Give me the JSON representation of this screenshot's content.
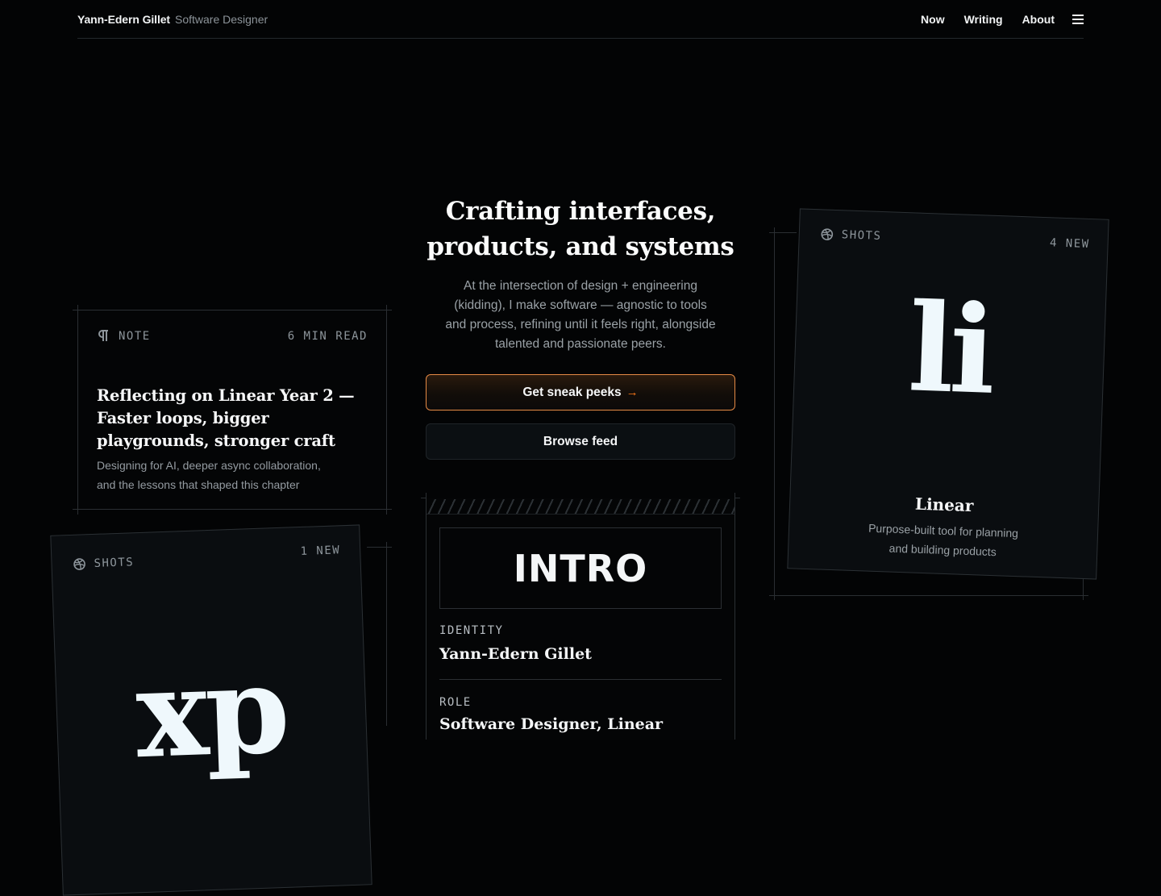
{
  "header": {
    "name": "Yann-Edern Gillet",
    "role": "Software Designer",
    "nav": [
      "Now",
      "Writing",
      "About"
    ],
    "menu_icon": "hamburger-icon"
  },
  "hero": {
    "title_line1": "Crafting interfaces,",
    "title_line2": "products, and systems",
    "subtitle": "At the intersection of design + engineering (kidding), I make software — agnostic to tools and process, refining until it feels right, alongside talented and passionate peers.",
    "primary_cta": "Get sneak peeks",
    "primary_cta_arrow": "→",
    "secondary_cta": "Browse feed"
  },
  "note_card": {
    "tag": "NOTE",
    "tag_icon": "pilcrow-icon",
    "meta": "6 MIN READ",
    "title": "Reflecting on Linear Year 2 — Faster loops, bigger playgrounds, stronger craft",
    "description": "Designing for AI, deeper async collaboration, and the lessons that shaped this chapter"
  },
  "shots_right": {
    "tag": "SHOTS",
    "tag_icon": "dribbble-icon",
    "meta": "4 NEW",
    "logo": "li",
    "title": "Linear",
    "description": "Purpose-built tool for planning and building products"
  },
  "shots_left": {
    "tag": "SHOTS",
    "tag_icon": "dribbble-icon",
    "meta": "1 NEW",
    "logo": "xp"
  },
  "intro_card": {
    "heading": "INTRO",
    "identity_label": "IDENTITY",
    "identity_value": "Yann-Edern Gillet",
    "role_label": "ROLE",
    "role_value": "Software Designer, Linear"
  },
  "colors": {
    "background": "#030405",
    "accent": "#e58a45",
    "arrow": "#ff7a1a"
  }
}
